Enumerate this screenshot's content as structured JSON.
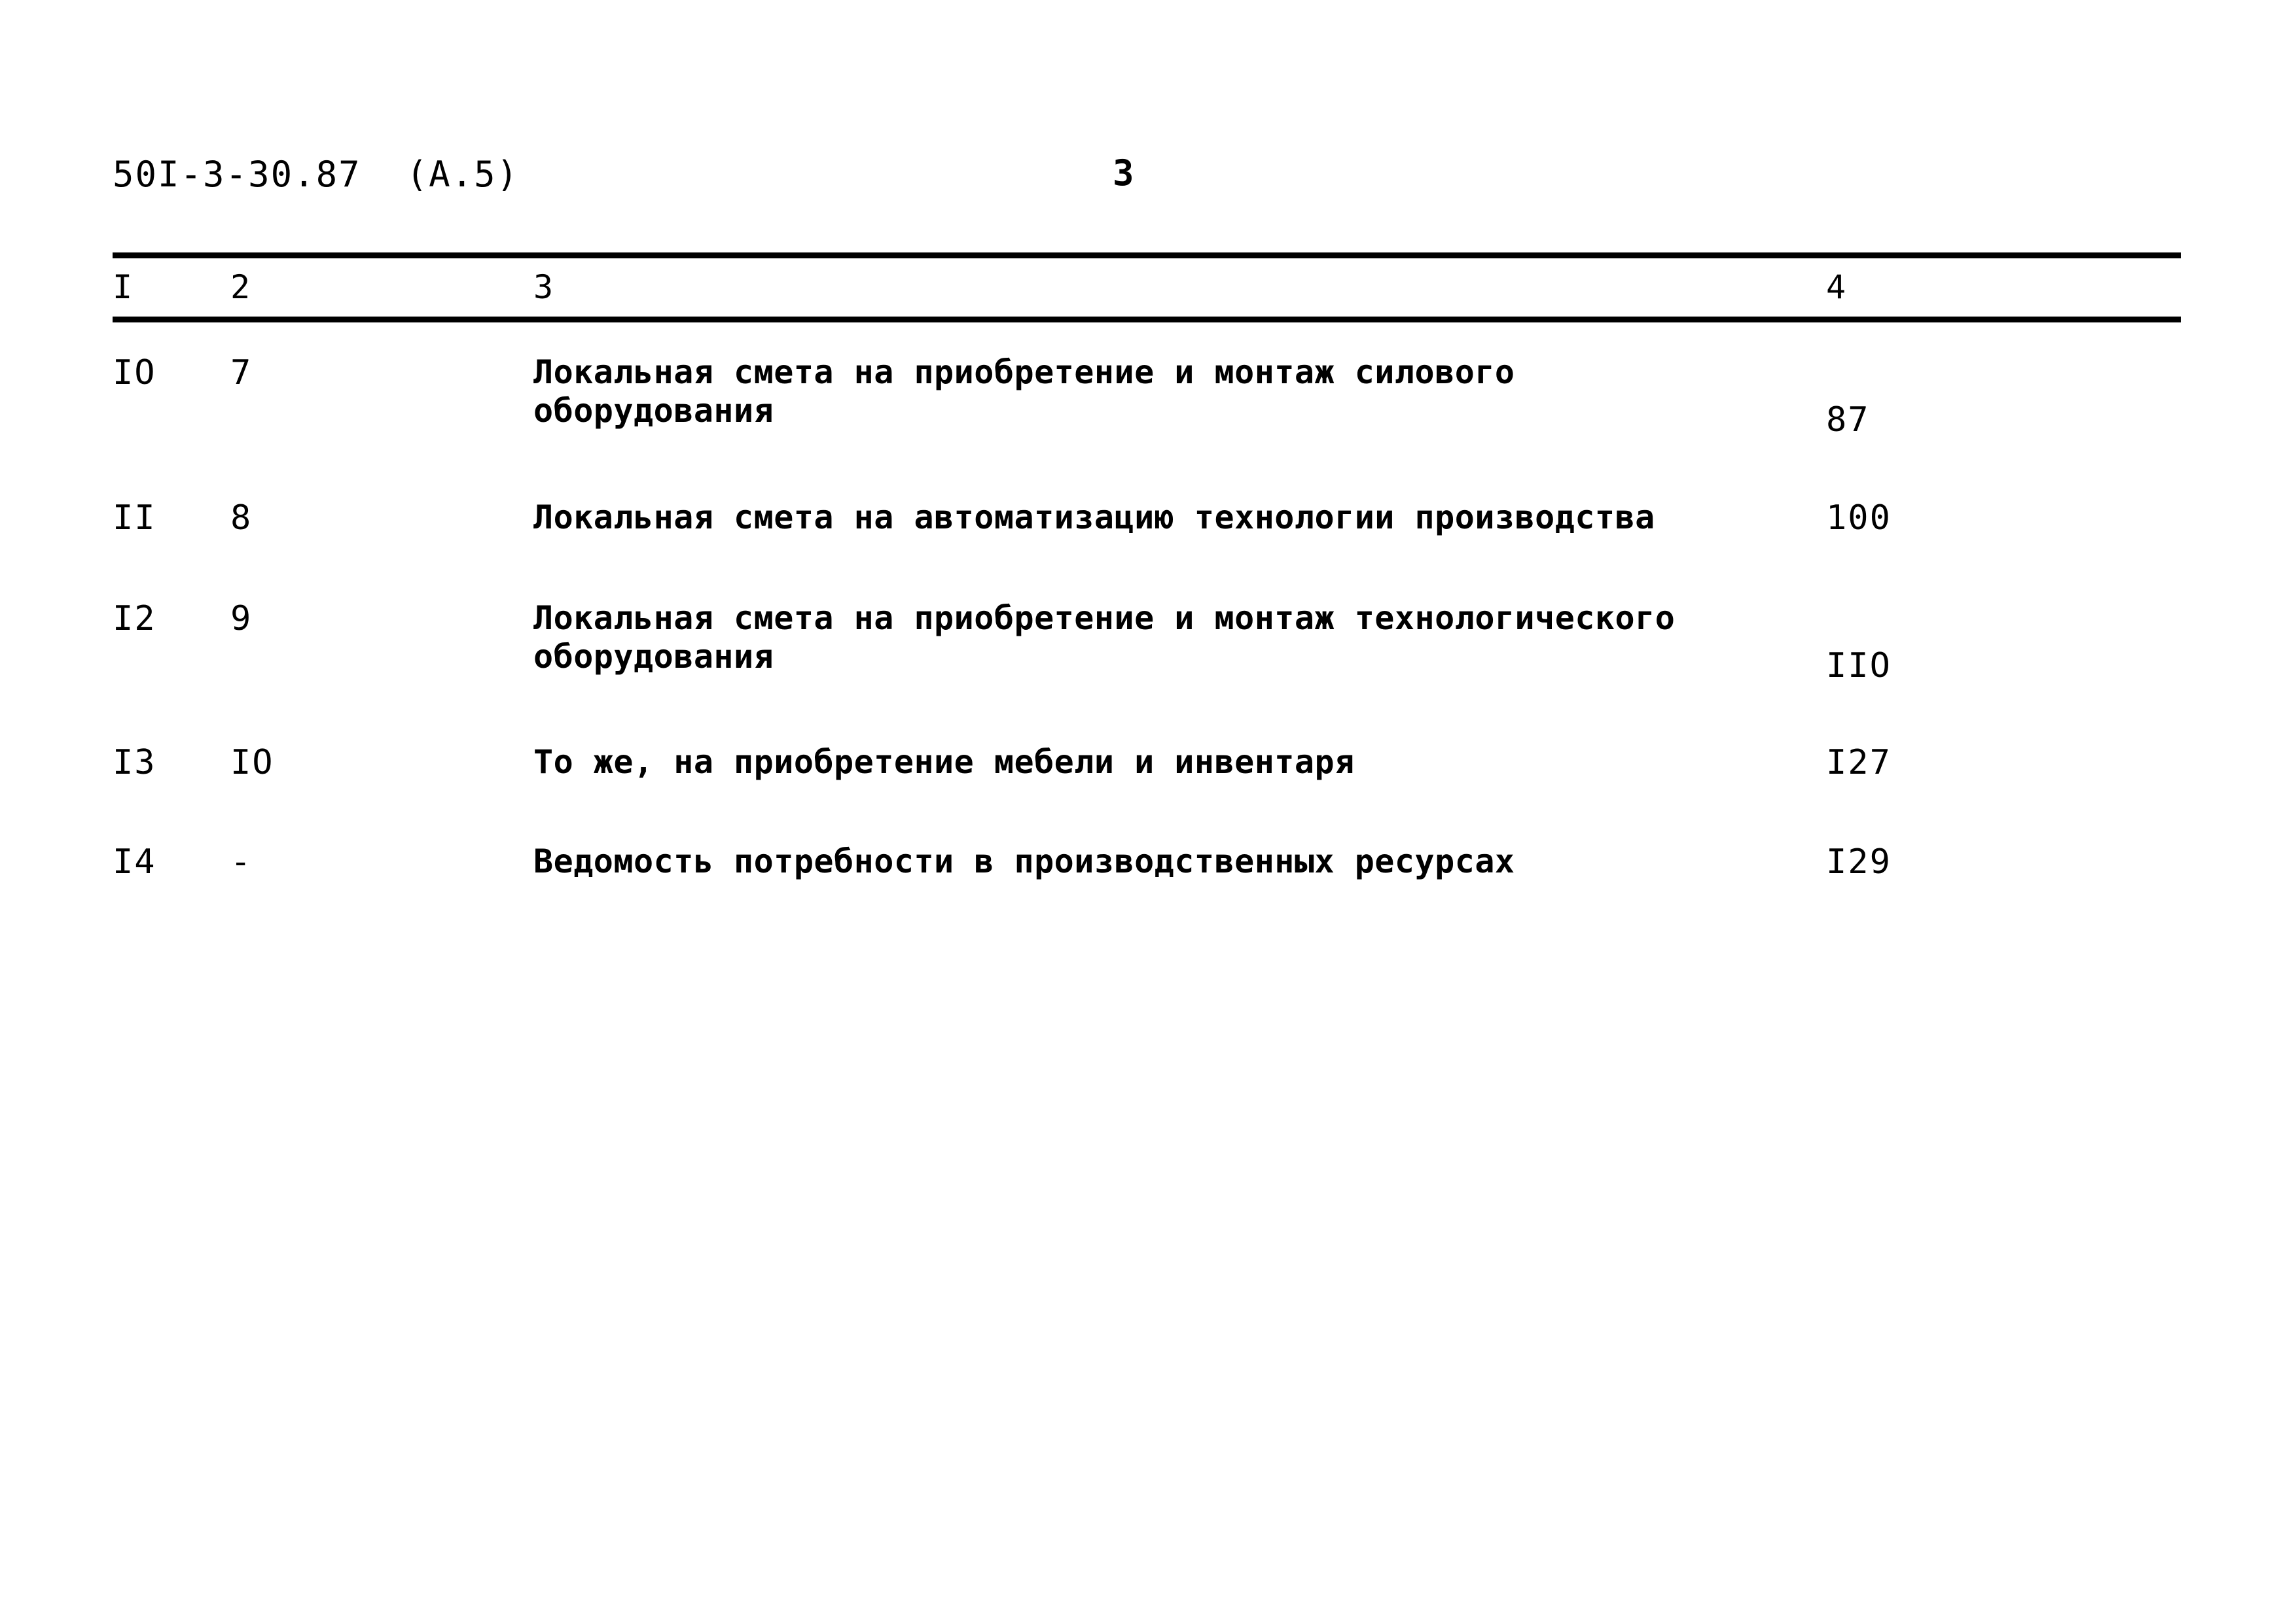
{
  "document": {
    "code": "50I-3-30.87  (A.5)",
    "page_number": "3"
  },
  "table": {
    "headers": {
      "col1": "I",
      "col2": "2",
      "col3": "3",
      "col4": "4"
    },
    "rows": [
      {
        "num": "IO",
        "sheet": "7",
        "title": "Локальная смета на приобретение и монтаж силового\nоборудования",
        "page": "87",
        "page_offset": true
      },
      {
        "num": "II",
        "sheet": "8",
        "title": "Локальная смета на автоматизацию технологии производства",
        "page": "100",
        "page_offset": false
      },
      {
        "num": "I2",
        "sheet": "9",
        "title": "Локальная смета на приобретение и монтаж технологического\nоборудования",
        "page": "IIO",
        "page_offset": true
      },
      {
        "num": "I3",
        "sheet": "IO",
        "title": "То же, на приобретение мебели и инвентаря",
        "page": "I27",
        "page_offset": false
      },
      {
        "num": "I4",
        "sheet": "-",
        "title": "Ведомость потребности в производственных ресурсах",
        "page": "I29",
        "page_offset": false
      }
    ]
  },
  "colors": {
    "ink": "#000000",
    "paper": "#ffffff"
  }
}
